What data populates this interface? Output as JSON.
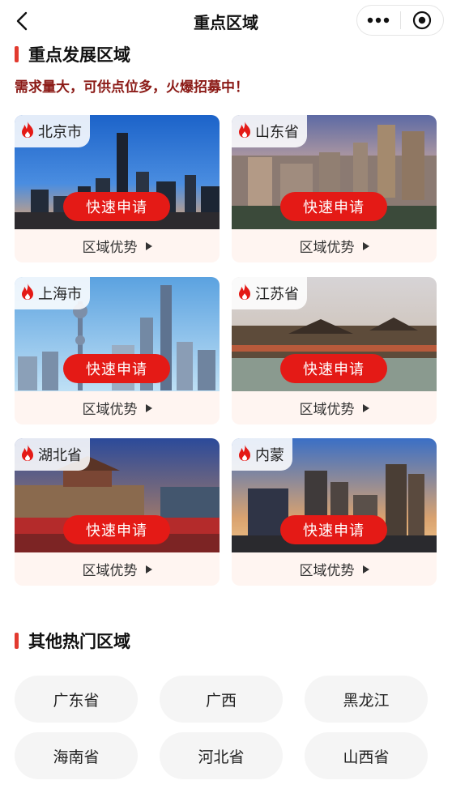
{
  "nav": {
    "title": "重点区域"
  },
  "focus": {
    "title": "重点发展区域",
    "subtitle": "需求量大，可供点位多，火爆招募中！",
    "cards": [
      {
        "name": "北京市",
        "apply": "快速申请",
        "advantage": "区域优势"
      },
      {
        "name": "山东省",
        "apply": "快速申请",
        "advantage": "区域优势"
      },
      {
        "name": "上海市",
        "apply": "快速申请",
        "advantage": "区域优势"
      },
      {
        "name": "江苏省",
        "apply": "快速申请",
        "advantage": "区域优势"
      },
      {
        "name": "湖北省",
        "apply": "快速申请",
        "advantage": "区域优势"
      },
      {
        "name": "内蒙",
        "apply": "快速申请",
        "advantage": "区域优势"
      }
    ]
  },
  "other": {
    "title": "其他热门区域",
    "regions": [
      "广东省",
      "广西",
      "黑龙江",
      "海南省",
      "河北省",
      "山西省"
    ]
  },
  "colors": {
    "accent": "#e41a16",
    "subtitle": "#8b1a16",
    "cardBg": "#fff5f1"
  },
  "icons": [
    "back-arrow-icon",
    "more-dots-icon",
    "close-target-icon",
    "flame-icon",
    "triangle-right-icon"
  ]
}
